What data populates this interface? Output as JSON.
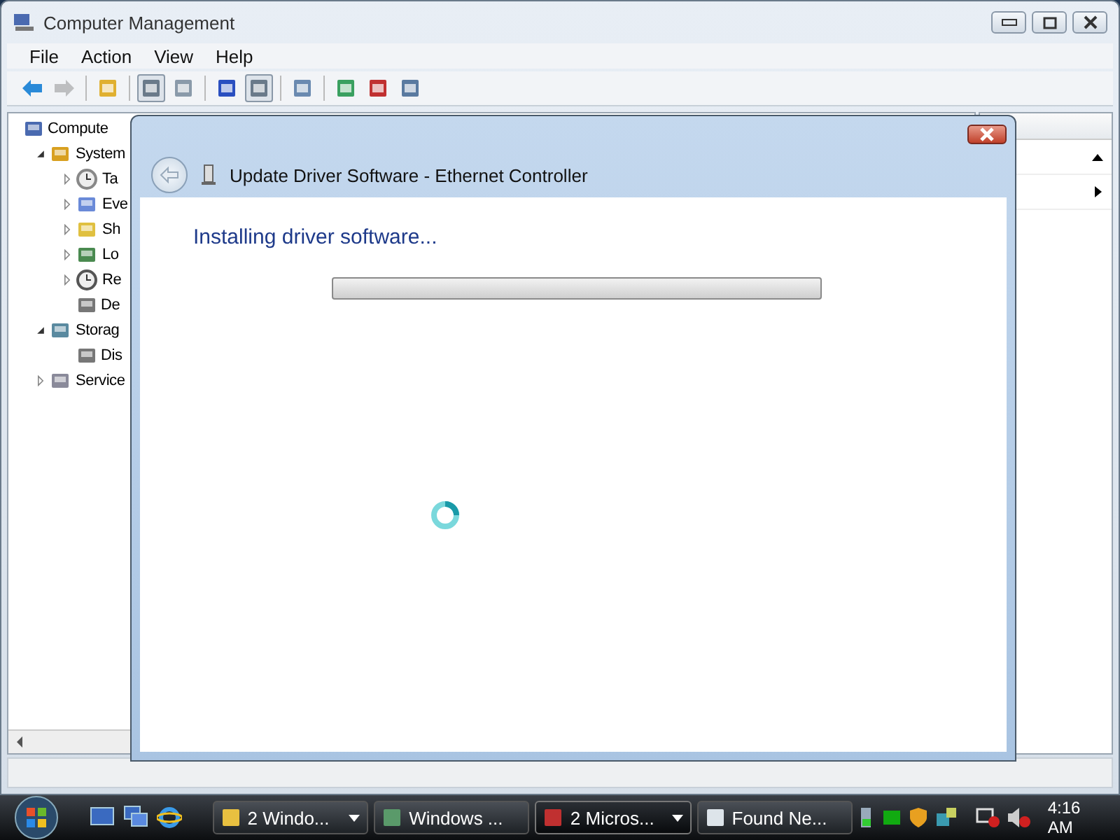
{
  "window": {
    "title": "Computer Management"
  },
  "menu": [
    "File",
    "Action",
    "View",
    "Help"
  ],
  "toolbar": [
    {
      "pressed": false,
      "disabled": false
    },
    {
      "pressed": false,
      "disabled": true
    },
    {
      "pressed": false,
      "disabled": false
    },
    {
      "pressed": true,
      "disabled": false
    },
    {
      "pressed": false,
      "disabled": false
    },
    {
      "pressed": false,
      "disabled": false
    },
    {
      "pressed": true,
      "disabled": false
    },
    {
      "pressed": false,
      "disabled": false
    },
    {
      "pressed": false,
      "disabled": false
    },
    {
      "pressed": false,
      "disabled": false
    },
    {
      "pressed": false,
      "disabled": false
    }
  ],
  "tree": [
    {
      "label": "Compute",
      "children": [
        {
          "label": "System",
          "expanded": true,
          "children": [
            {
              "label": "Ta",
              "expanded": false
            },
            {
              "label": "Eve",
              "expanded": false
            },
            {
              "label": "Sh",
              "expanded": false
            },
            {
              "label": "Lo",
              "expanded": false
            },
            {
              "label": "Re",
              "expanded": false
            },
            {
              "label": "De"
            }
          ]
        },
        {
          "label": "Storag",
          "expanded": true,
          "children": [
            {
              "label": "Dis"
            }
          ]
        },
        {
          "label": "Service",
          "expanded": false
        }
      ]
    }
  ],
  "dialog": {
    "title": "Update Driver Software - Ethernet Controller",
    "heading": "Installing driver software...",
    "level": 0
  },
  "taskbar": {
    "buttons": [
      {
        "label": "2 Windo...",
        "grouped": true,
        "selected": false
      },
      {
        "label": "Windows ...",
        "grouped": false,
        "selected": false
      },
      {
        "label": "2 Micros...",
        "grouped": true,
        "selected": true
      },
      {
        "label": "Found Ne...",
        "grouped": false,
        "selected": false
      }
    ],
    "clock": "4:16 AM"
  }
}
